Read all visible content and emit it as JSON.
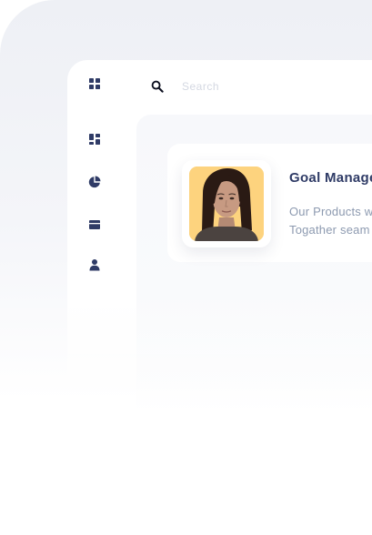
{
  "search": {
    "placeholder": "Search"
  },
  "sidebar": {
    "items": [
      {
        "icon": "grid-icon"
      },
      {
        "icon": "dashboard-icon"
      },
      {
        "icon": "pie-chart-icon"
      },
      {
        "icon": "card-icon"
      },
      {
        "icon": "user-icon"
      }
    ]
  },
  "card": {
    "title": "Goal Manage",
    "description_lines": [
      "Our Products w",
      "Togather seam"
    ],
    "avatar_bg": "#fdd37e"
  },
  "colors": {
    "icon": "#2f3b66",
    "title": "#2f3b66",
    "description": "#8d9ab0",
    "placeholder": "#d4d8e2"
  }
}
